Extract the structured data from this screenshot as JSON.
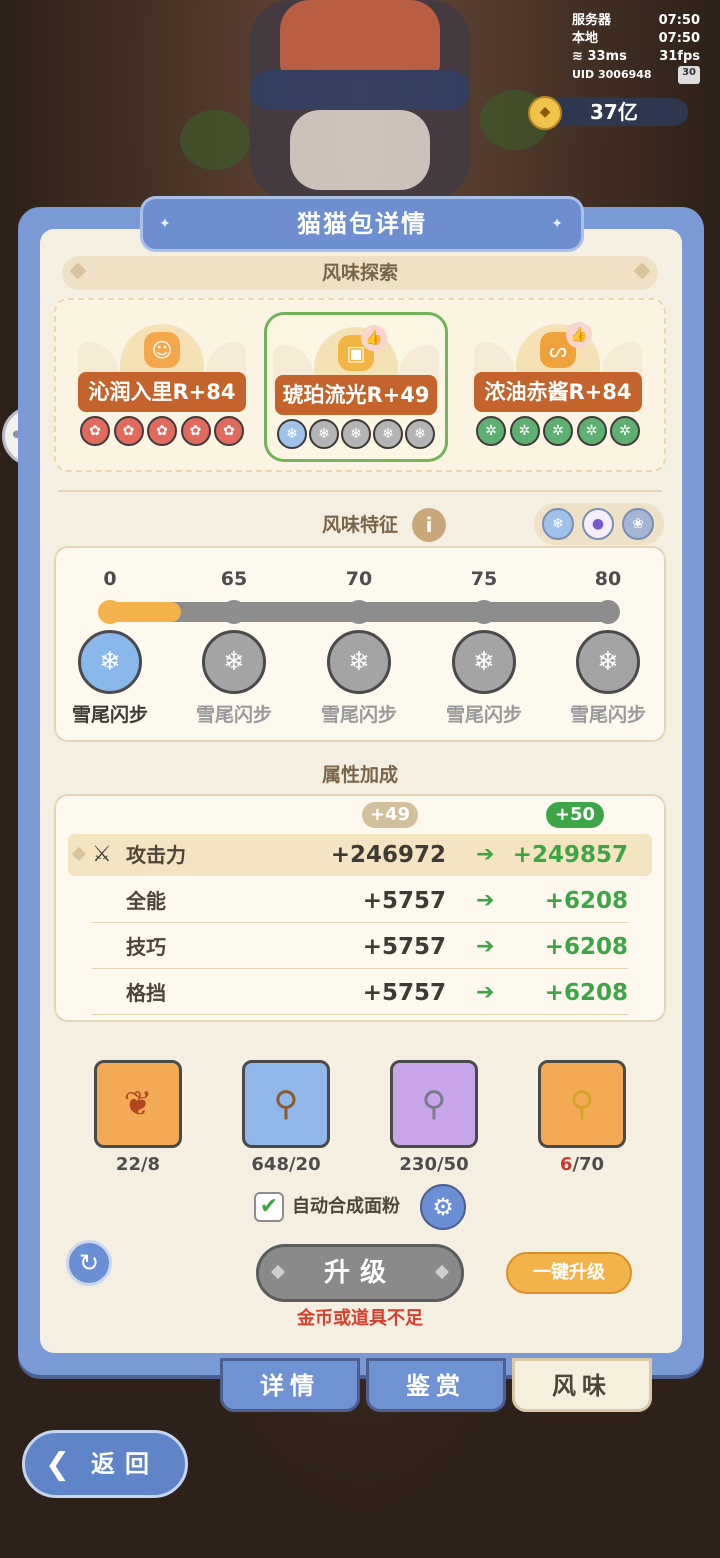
{
  "status": {
    "server_label": "服务器",
    "server_time": "07:50",
    "local_label": "本地",
    "local_time": "07:50",
    "ping": "33ms",
    "fps": "31fps",
    "uid": "UID 3006948",
    "battery": "30"
  },
  "currency": {
    "amount": "37亿"
  },
  "panel": {
    "title": "猫猫包详情",
    "flavor_section": "风味探索",
    "flavors": [
      {
        "name": "沁润入里R+84",
        "runes": [
          "red",
          "red",
          "red",
          "red",
          "red"
        ]
      },
      {
        "name": "琥珀流光R+49",
        "runes": [
          "blue",
          "gray",
          "gray",
          "gray",
          "gray"
        ],
        "selected": true
      },
      {
        "name": "浓油赤酱R+84",
        "runes": [
          "green",
          "green",
          "green",
          "green",
          "green"
        ]
      }
    ],
    "feature_section": "风味特征",
    "progress": {
      "ticks": [
        "0",
        "65",
        "70",
        "75",
        "80"
      ],
      "current_value": 49,
      "skills": [
        "雪尾闪步",
        "雪尾闪步",
        "雪尾闪步",
        "雪尾闪步",
        "雪尾闪步"
      ]
    },
    "attr_section": "属性加成",
    "attr_cur_level": "+49",
    "attr_next_level": "+50",
    "attributes": [
      {
        "name": "攻击力",
        "cur": "+246972",
        "next": "+249857"
      },
      {
        "name": "全能",
        "cur": "+5757",
        "next": "+6208"
      },
      {
        "name": "技巧",
        "cur": "+5757",
        "next": "+6208"
      },
      {
        "name": "格挡",
        "cur": "+5757",
        "next": "+6208"
      }
    ],
    "items": [
      {
        "count": "22/8"
      },
      {
        "count": "648/20"
      },
      {
        "count": "230/50"
      },
      {
        "have": "6",
        "need": "/70"
      }
    ],
    "auto_label": "自动合成面粉",
    "upgrade_label": "升级",
    "onekey_label": "一键升级",
    "warning": "金币或道具不足",
    "tabs": [
      "详情",
      "鉴赏",
      "风味"
    ]
  },
  "back_label": "返回",
  "colors": {
    "accent": "#6f92d2",
    "gold": "#f3b34a",
    "green": "#3ea547",
    "warn": "#d6402e"
  }
}
